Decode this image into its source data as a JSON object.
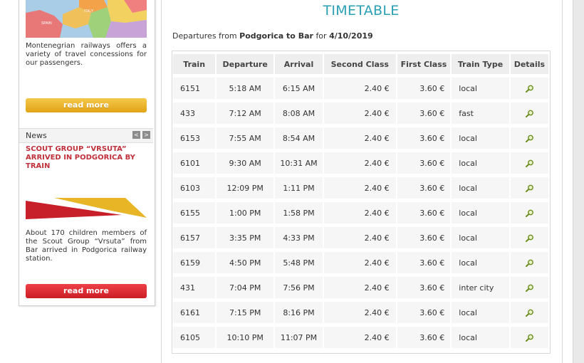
{
  "sidebar": {
    "promo_text": "Montenegrian railways offers a variety of travel concessions for our passengers.",
    "read_more_1": "read more",
    "map_label": "SPAIN",
    "map_label_2": "ITALY",
    "news_label": "News",
    "news_prev": "<",
    "news_next": ">",
    "news_title": "SCOUT GROUP “VRSUTA” ARRIVED IN PODGORICA BY TRAIN",
    "news_text": "About 170 children members of the Scout Group “Vrsuta” from Bar arrived in Podgorica railway station.",
    "read_more_2": "read more"
  },
  "main": {
    "title": "TIMETABLE",
    "route_prefix": "Departures from",
    "route": "Podgorica to Bar",
    "date_prefix": "for",
    "date": "4/10/2019"
  },
  "table": {
    "headers": [
      "Train",
      "Departure",
      "Arrival",
      "Second Class",
      "First Class",
      "Train Type",
      "Details"
    ],
    "rows": [
      [
        "6151",
        "5:18 AM",
        "6:15 AM",
        "2.40 €",
        "3.60 €",
        "local"
      ],
      [
        "433",
        "7:12 AM",
        "8:08 AM",
        "2.40 €",
        "3.60 €",
        "fast"
      ],
      [
        "6153",
        "7:55 AM",
        "8:54 AM",
        "2.40 €",
        "3.60 €",
        "local"
      ],
      [
        "6101",
        "9:30 AM",
        "10:31 AM",
        "2.40 €",
        "3.60 €",
        "local"
      ],
      [
        "6103",
        "12:09 PM",
        "1:11 PM",
        "2.40 €",
        "3.60 €",
        "local"
      ],
      [
        "6155",
        "1:00 PM",
        "1:58 PM",
        "2.40 €",
        "3.60 €",
        "local"
      ],
      [
        "6157",
        "3:35 PM",
        "4:33 PM",
        "2.40 €",
        "3.60 €",
        "local"
      ],
      [
        "6159",
        "4:50 PM",
        "5:48 PM",
        "2.40 €",
        "3.60 €",
        "local"
      ],
      [
        "431",
        "7:04 PM",
        "7:56 PM",
        "2.40 €",
        "3.60 €",
        "inter city"
      ],
      [
        "6161",
        "7:15 PM",
        "8:16 PM",
        "2.40 €",
        "3.60 €",
        "local"
      ],
      [
        "6105",
        "10:10 PM",
        "11:07 PM",
        "2.40 €",
        "3.60 €",
        "local"
      ]
    ],
    "details_icon": "magnifier-icon"
  },
  "colors": {
    "title": "#2aa0b4",
    "read_more_yellow": "#e9b22c",
    "read_more_red": "#dd2a31",
    "news_title": "#c0303a"
  }
}
